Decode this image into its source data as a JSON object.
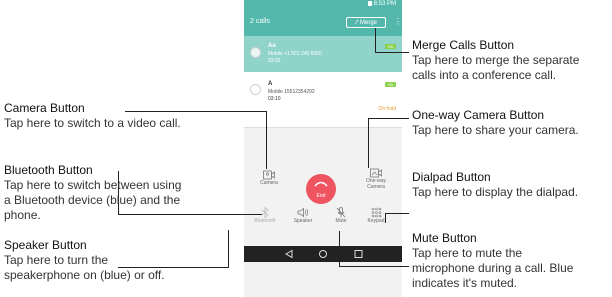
{
  "statusbar": {
    "time": "8:53 PM"
  },
  "header": {
    "calls_count": "2 calls",
    "merge_label": "Merge",
    "menu": "⋮"
  },
  "call1": {
    "name": "Aa",
    "number": "Mobile +1 551 245 6060",
    "time": "03:02",
    "badge": "HD"
  },
  "call2": {
    "name": "A",
    "number": "Mobile 15512354292",
    "time": "03:10",
    "badge": "HD",
    "status": "On hold"
  },
  "controls": {
    "camera": "Camera",
    "end": "End",
    "oneway_line1": "One-way",
    "oneway_line2": "Camera",
    "bluetooth": "Bluetooth",
    "speaker": "Speaker",
    "mute": "Mute",
    "keypad": "Keypad"
  },
  "colors": {
    "accent": "#54b7ab",
    "end": "#ef5561",
    "hd": "#8ad14b",
    "hold": "#e59b2f"
  },
  "callouts": {
    "merge": {
      "title": "Merge Calls Button",
      "l1": "Tap here to merge the separate",
      "l2": "calls into a conference call."
    },
    "oneway": {
      "title": "One-way Camera Button",
      "l1": "Tap here to share your camera."
    },
    "dialpad": {
      "title": "Dialpad Button",
      "l1": "Tap here to display the dialpad."
    },
    "mute": {
      "title": "Mute Button",
      "l1": "Tap here to mute the",
      "l2": "microphone during a call. Blue",
      "l3": "indicates it's muted."
    },
    "camera": {
      "title": "Camera Button",
      "l1": "Tap here to switch to a video call."
    },
    "bluetooth": {
      "title": "Bluetooth Button",
      "l1": "Tap here to switch between using",
      "l2": "a Bluetooth device (blue) and the",
      "l3": "phone."
    },
    "speaker": {
      "title": "Speaker Button",
      "l1": "Tap here to turn the",
      "l2": "speakerphone on (blue) or off."
    }
  }
}
